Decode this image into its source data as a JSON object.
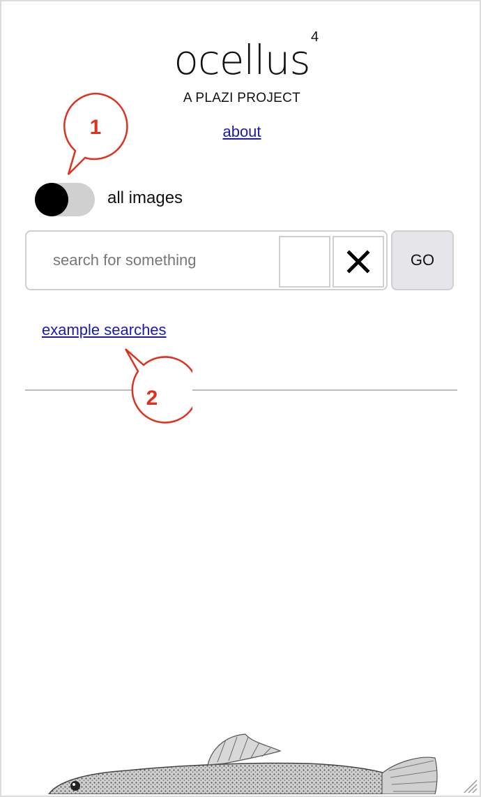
{
  "logo": {
    "word": "ocellus",
    "version": "4"
  },
  "subtitle": "A PLAZI PROJECT",
  "about_link": "about",
  "toggle": {
    "label": "all images",
    "state": "off"
  },
  "search": {
    "placeholder": "search for something",
    "value": "",
    "go_label": "GO"
  },
  "example_link": "example searches",
  "callouts": [
    {
      "number": "1"
    },
    {
      "number": "2"
    }
  ],
  "colors": {
    "link": "#1b1bb3",
    "callout": "#e0301e",
    "toggle_track": "#d0d0d0",
    "go_bg": "#e6e6ea"
  },
  "icons": {
    "clear": "close-icon",
    "illustration": "fish-illustration",
    "resize": "resize-handle-icon"
  }
}
